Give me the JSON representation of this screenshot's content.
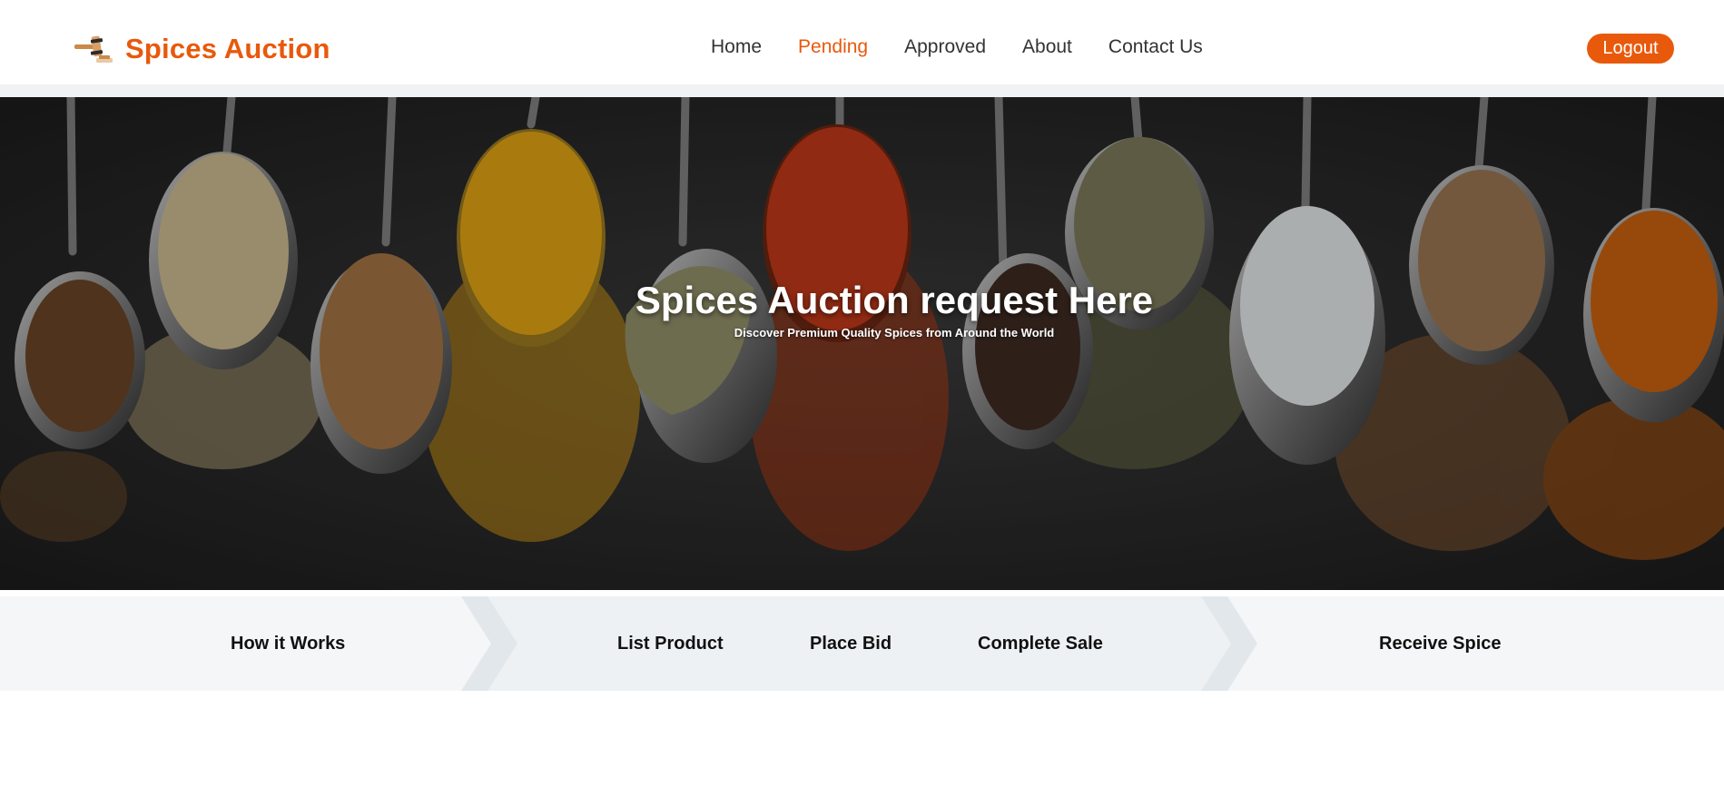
{
  "brand": {
    "name": "Spices Auction",
    "icon": "gavel-icon"
  },
  "nav": {
    "links": [
      {
        "label": "Home",
        "active": false
      },
      {
        "label": "Pending",
        "active": true
      },
      {
        "label": "Approved",
        "active": false
      },
      {
        "label": "About",
        "active": false
      },
      {
        "label": "Contact Us",
        "active": false
      }
    ],
    "logout_label": "Logout"
  },
  "hero": {
    "title": "Spices Auction request Here",
    "subtitle": "Discover Premium Quality Spices from Around the World"
  },
  "steps": {
    "how": "How it Works",
    "items": [
      "List Product",
      "Place Bid",
      "Complete Sale"
    ],
    "final": "Receive Spice"
  },
  "colors": {
    "accent": "#e8590c",
    "text": "#333333",
    "strip": "#f5f6f7"
  }
}
